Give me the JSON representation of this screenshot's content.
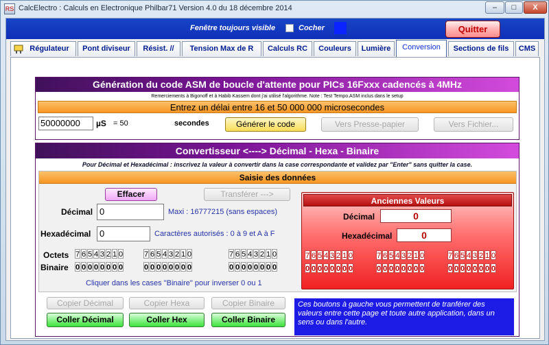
{
  "window": {
    "title": "CalcElectro : Calculs en Electronique    Philbar71    Version  4.0 du 18 décembre 2014",
    "minimize": "–",
    "maximize": "□",
    "close": "X"
  },
  "topbar": {
    "always_visible": "Fenêtre toujours visible",
    "cocher": "Cocher",
    "quit": "Quitter"
  },
  "tabs": [
    {
      "label": "Régulateur"
    },
    {
      "label": "Pont diviseur"
    },
    {
      "label": "Résist. //"
    },
    {
      "label": "Tension Max de R"
    },
    {
      "label": "Calculs RC"
    },
    {
      "label": "Couleurs"
    },
    {
      "label": "Lumière"
    },
    {
      "label": "Conversion"
    },
    {
      "label": "Sections de fils"
    },
    {
      "label": "CMS"
    }
  ],
  "tab_icon_text": "RS",
  "asm": {
    "title": "Génération du code ASM de boucle d'attente pour PICs 16Fxxx cadencés à 4MHz",
    "thanks": "Remerciements à Bigonoff  et  à Habib Kassem  dont j'ai utilisé l'algorithme.      Note : Test Tempo.ASM inclus dans le setup",
    "delay_prompt": "Entrez un délai entre 16 et 50 000 000 microsecondes",
    "delay_value": "50000000",
    "unit": "µS",
    "equals": "=  50",
    "seconds": "secondes",
    "generate": "Générer le code",
    "to_clipboard": "Vers Presse-papier",
    "to_file": "Vers Fichier..."
  },
  "converter": {
    "title": "Convertisseur <----> Décimal - Hexa - Binaire",
    "instructions": "Pour Décimal et Hexadécimal : inscrivez la valeur à convertir dans la case correspondante et validez par \"Enter\" sans quitter la case.",
    "input_header": "Saisie des données",
    "erase": "Effacer",
    "transfer": "Transférer --->",
    "decimal_label": "Décimal",
    "decimal_value": "0",
    "decimal_info": "Maxi : 16777215 (sans espaces)",
    "hex_label": "Hexadécimal",
    "hex_value": "0",
    "hex_info": "Caractères autorisés : 0 à 9 et A à F",
    "octets_label": "Octets",
    "binary_label": "Binaire",
    "bit_positions": [
      "7",
      "6",
      "5",
      "4",
      "3",
      "2",
      "1",
      "0"
    ],
    "bits": [
      "0",
      "0",
      "0",
      "0",
      "0",
      "0",
      "0",
      "0"
    ],
    "click_hint": "Cliquer dans les cases \"Binaire\" pour inverser 0 ou 1",
    "old_values_header": "Anciennes Valeurs",
    "old_decimal_label": "Décimal",
    "old_decimal_value": "0",
    "old_hex_label": "Hexadécimal",
    "old_hex_value": "0",
    "copy_decimal": "Copier Décimal",
    "copy_hex": "Copier Hexa",
    "copy_binary": "Copier Binaire",
    "paste_decimal": "Coller Décimal",
    "paste_hex": "Coller Hex",
    "paste_binary": "Coller Binaire",
    "note": "Ces boutons à gauche vous permettent de tranférer des valeurs entre cette page et  toute autre application, dans un sens ou dans l'autre."
  }
}
